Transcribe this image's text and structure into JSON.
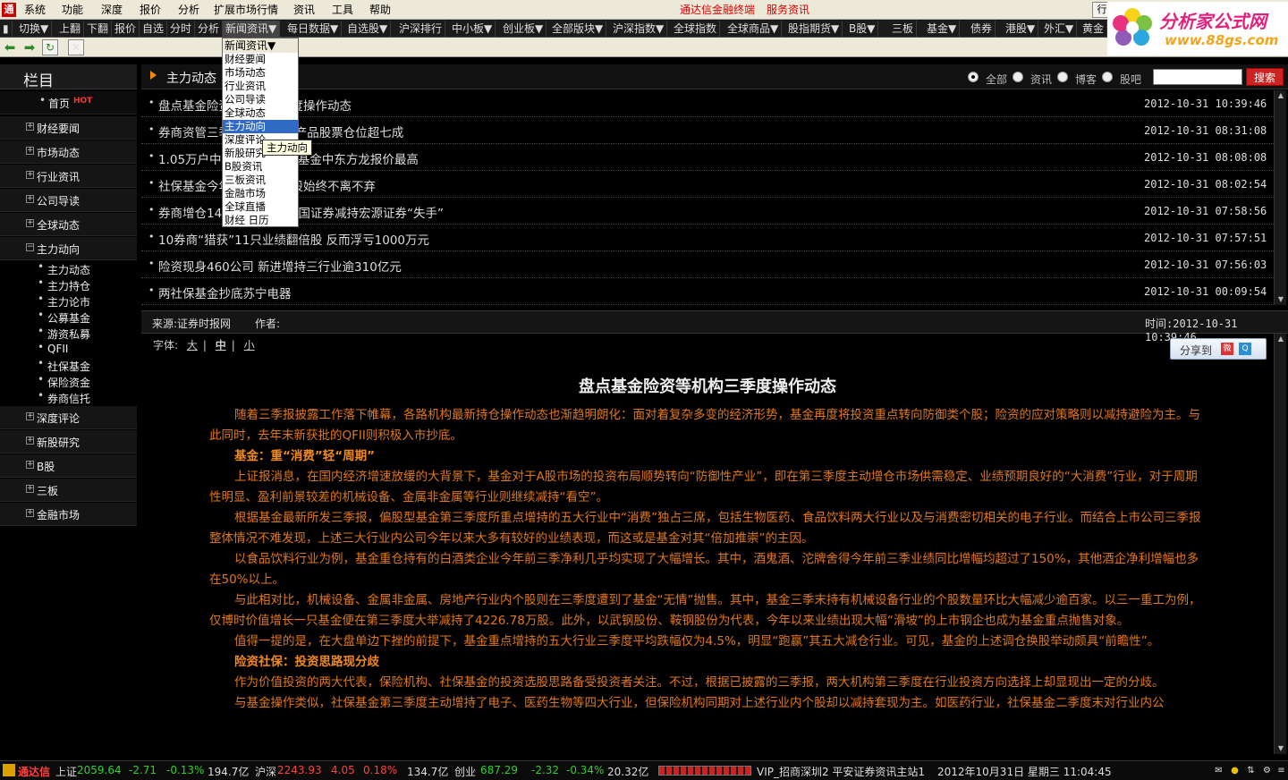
{
  "menubar": {
    "items": [
      "系统",
      "功能",
      "深度",
      "报价",
      "分析",
      "扩展市场行情",
      "资讯",
      "工具",
      "帮助"
    ],
    "promo1": "通达信金融终端",
    "promo2": "服务资讯",
    "right_btn": "行"
  },
  "toolbar": {
    "items": [
      "切换▼",
      "上翻",
      "下翻",
      "报价",
      "自选",
      "分时",
      "分析",
      "新闻资讯▼",
      "每日数据▼",
      "自选股▼",
      "沪深排行",
      "中小板▼",
      "创业板▼",
      "全部版块▼",
      "沪深指数▼",
      "全球指数",
      "全球商品▼",
      "股指期货▼",
      "B股▼",
      "三板",
      "基金▼",
      "债券",
      "港股▼",
      "外汇▼",
      "黄金"
    ]
  },
  "brand": {
    "title": "分析家公式网",
    "url": "www.88gs.com"
  },
  "sidebar": {
    "title": "栏目",
    "home": "首页",
    "hot": "HOT",
    "cats_top": [
      "财经要闻",
      "市场动态",
      "行业资讯",
      "公司导读",
      "全球动态",
      "主力动向"
    ],
    "subs": [
      "主力动态",
      "主力持仓",
      "主力论市",
      "公募基金",
      "游资私募",
      "QFII",
      "社保基金",
      "保险资金",
      "券商信托"
    ],
    "cats_bottom": [
      "深度评论",
      "新股研究",
      "B股",
      "三板",
      "金融市场"
    ]
  },
  "panel": {
    "title": "主力动态",
    "filters": [
      "全部",
      "资讯",
      "博客",
      "股吧"
    ],
    "search_label": "搜索"
  },
  "news": [
    {
      "title": "盘点基金险资等机构三季度操作动态",
      "date": "2012-10-31  10:39:46"
    },
    {
      "title": "券商资管三季度加仓 自营产品股票仓位超七成",
      "date": "2012-10-31  08:31:08"
    },
    {
      "title": "1.05万户中小企业私募债 基金中东方龙报价最高",
      "date": "2012-10-31  08:08:08"
    },
    {
      "title": "社保基金今年以来对银行股始终不离不弃",
      "date": "2012-10-31  08:02:54"
    },
    {
      "title": "券商增仓14只个股 申银万国证券减持宏源证券“失手”",
      "date": "2012-10-31  07:58:56"
    },
    {
      "title": "10券商“猎获”11只业绩翻倍股 反而浮亏1000万元",
      "date": "2012-10-31  07:57:51"
    },
    {
      "title": "险资现身460公司 新进增持三行业逾310亿元",
      "date": "2012-10-31  07:56:03"
    },
    {
      "title": "两社保基金抄底苏宁电器",
      "date": "2012-10-31  00:09:54"
    }
  ],
  "meta": {
    "source": "来源:证券时报网",
    "author": "作者:",
    "time": "时间:2012-10-31  10:39:46"
  },
  "article": {
    "font_label": "字体:",
    "font_sizes": [
      "大",
      "中",
      "小"
    ],
    "share": "分享到",
    "title": "盘点基金险资等机构三季度操作动态",
    "paragraphs": [
      "随着三季报披露工作落下帷幕，各路机构最新持仓操作动态也渐趋明朗化：面对着复杂多变的经济形势，基金再度将投资重点转向防御类个股；险资的应对策略则以减持避险为主。与此同时，去年末新获批的QFII则积极入市抄底。",
      "基金：重“消费”轻“周期”",
      "上证报消息，在国内经济增速放缓的大背景下，基金对于A股市场的投资布局顺势转向“防御性产业”，即在第三季度主动增仓市场供需稳定、业绩预期良好的“大消费”行业，对于周期性明显、盈利前景较差的机械设备、金属非金属等行业则继续减持“看空”。",
      "根据基金最新所发三季报，偏股型基金第三季度所重点增持的五大行业中“消费”独占三席，包括生物医药、食品饮料两大行业以及与消费密切相关的电子行业。而结合上市公司三季报整体情况不难发现，上述三大行业内公司今年以来大多有较好的业绩表现，而这或是基金对其“倍加推崇”的主因。",
      "以食品饮料行业为例，基金重仓持有的白酒类企业今年前三季净利几乎均实现了大幅增长。其中，酒鬼酒、沱牌舍得今年前三季业绩同比增幅均超过了150%，其他酒企净利增幅也多在50%以上。",
      "与此相对比，机械设备、金属非金属、房地产行业内个股则在三季度遭到了基金“无情”抛售。其中，基金三季末持有机械设备行业的个股数量环比大幅减少逾百家。以三一重工为例，仅博时价值增长一只基金便在第三季度大举减持了4226.78万股。此外，以武钢股份、鞍钢股份为代表，今年以来业绩出现大幅“滑坡”的上市钢企也成为基金重点抛售对象。",
      "值得一提的是，在大盘单边下挫的前提下，基金重点增持的五大行业三季度平均跌幅仅为4.5%，明显“跑赢”其五大减仓行业。可见，基金的上述调仓换股举动颇具“前瞻性”。",
      "险资社保：投资思路现分歧",
      "作为价值投资的两大代表，保险机构、社保基金的投资选股思路备受投资者关注。不过，根据已披露的三季报，两大机构第三季度在行业投资方向选择上却显现出一定的分歧。",
      "与基金操作类似，社保基金第三季度主动增持了电子、医药生物等四大行业，但保险机构同期对上述行业内个股却以减持套现为主。如医药行业，社保基金二季度末对行业内公"
    ]
  },
  "dropdown": {
    "header": "新闻资讯▼",
    "items": [
      "财经要闻",
      "市场动态",
      "行业资讯",
      "公司导读",
      "全球动态",
      "主力动向",
      "深度评论",
      "新股研究",
      "B股资讯",
      "三板资讯",
      "金融市场",
      "全球直播",
      "财经 日历"
    ],
    "selected_index": 5,
    "tooltip": "主力动向"
  },
  "status": {
    "app": "通达信",
    "sh_label": "上证",
    "sh_val": "2059.64",
    "sh_chg": "-2.71",
    "sh_pct": "-0.13%",
    "sh_amt": "194.7亿",
    "hs_label": "沪深",
    "hs_val": "2243.93",
    "hs_chg": "4.05",
    "hs_pct": "0.18%",
    "hs_amt": "134.7亿",
    "cy_label": "创业",
    "cy_val": "687.29",
    "cy_chg": "-2.32",
    "cy_pct": "-0.34%",
    "cy_amt": "20.32亿",
    "server": "VIP_招商深圳2  平安证券资讯主站1",
    "datetime": "2012年10月31日  星期三  11:04:45"
  },
  "colors": {
    "accent_orange": "#e07818",
    "up_red": "#ff4040",
    "down_green": "#2ed12e",
    "selected_blue": "#316ac5"
  }
}
